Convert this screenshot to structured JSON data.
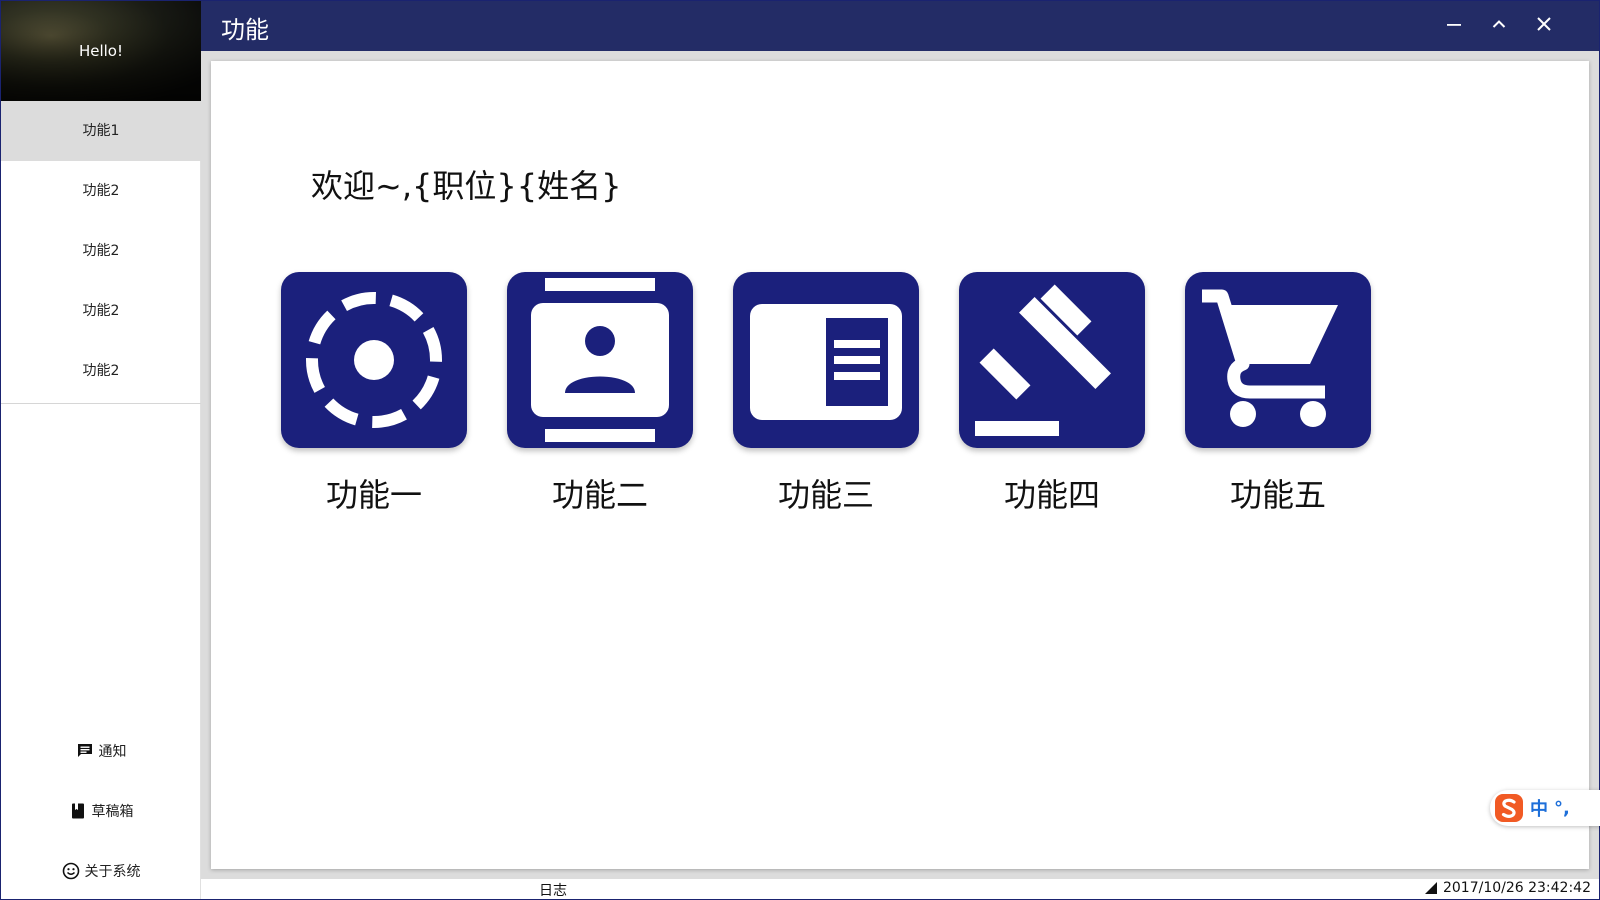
{
  "window": {
    "title": "功能"
  },
  "sidebar": {
    "greeting": "Hello!",
    "items": [
      {
        "label": "功能1",
        "active": true
      },
      {
        "label": "功能2",
        "active": false
      },
      {
        "label": "功能2",
        "active": false
      },
      {
        "label": "功能2",
        "active": false
      },
      {
        "label": "功能2",
        "active": false
      }
    ],
    "bottom": [
      {
        "label": "通知",
        "icon": "message-icon"
      },
      {
        "label": "草稿箱",
        "icon": "book-icon"
      },
      {
        "label": "关于系统",
        "icon": "smiley-icon"
      }
    ]
  },
  "main": {
    "welcome": "欢迎~,{职位}{姓名}",
    "features": [
      {
        "label": "功能一",
        "icon": "settings-circle-icon"
      },
      {
        "label": "功能二",
        "icon": "contact-card-icon"
      },
      {
        "label": "功能三",
        "icon": "document-panel-icon"
      },
      {
        "label": "功能四",
        "icon": "gavel-icon"
      },
      {
        "label": "功能五",
        "icon": "shopping-cart-icon"
      }
    ]
  },
  "statusbar": {
    "log": "日志",
    "datetime": "2017/10/26 23:42:42"
  },
  "ime": {
    "mode": "中",
    "punct": "°,"
  },
  "colors": {
    "accent": "#1b207c",
    "titlebar": "#232c66"
  }
}
